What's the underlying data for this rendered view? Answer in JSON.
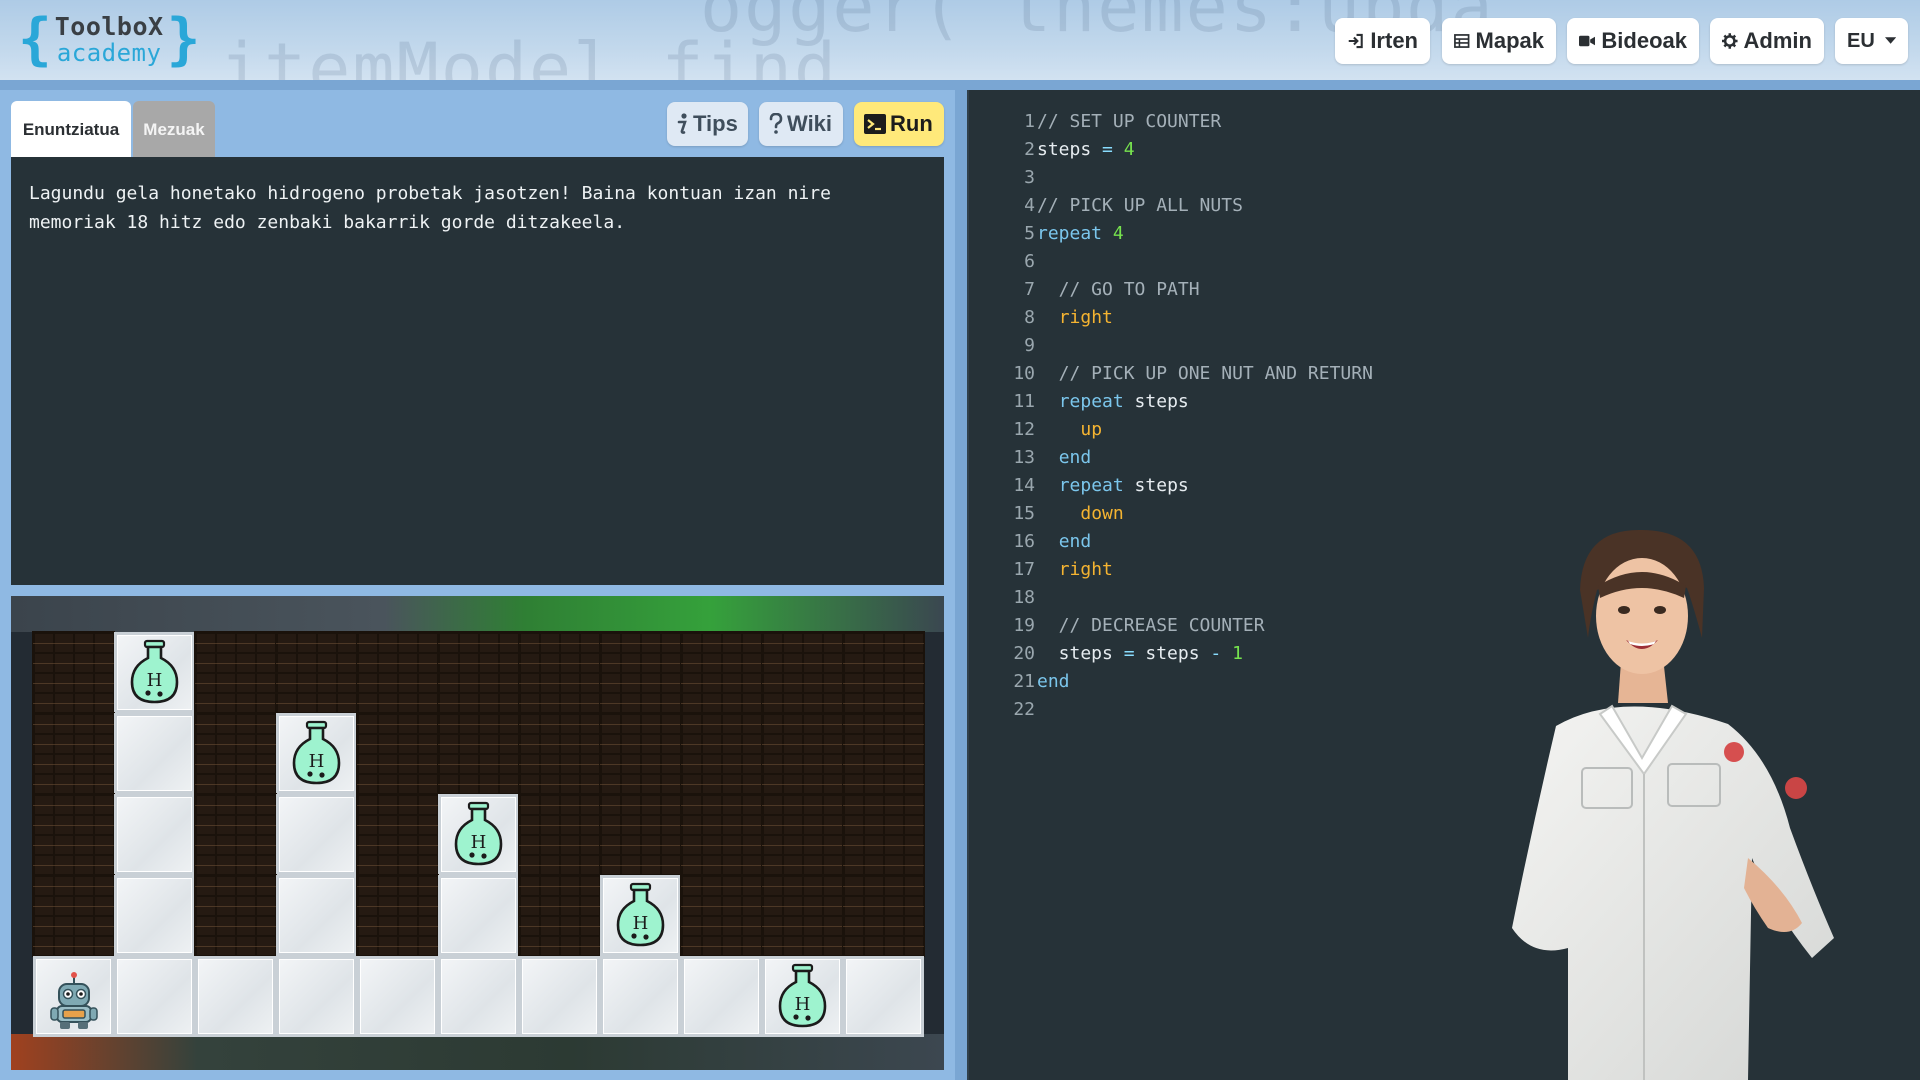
{
  "header": {
    "logo": {
      "line1": "ToolboX",
      "line2": "academy",
      "brace_open": "{",
      "brace_close": "}"
    },
    "background_code": {
      "line1": "ogger(\"themes:upda",
      "line2": "itemModel.find"
    },
    "nav": [
      {
        "label": "Irten",
        "icon": "sign-in-icon"
      },
      {
        "label": "Mapak",
        "icon": "table-icon"
      },
      {
        "label": "Bideoak",
        "icon": "video-camera-icon"
      },
      {
        "label": "Admin",
        "icon": "gear-icon"
      }
    ],
    "language": {
      "value": "EU",
      "icon": "caret-down-icon"
    }
  },
  "tabs": [
    {
      "label": "Enuntziatua",
      "active": true
    },
    {
      "label": "Mezuak",
      "active": false
    }
  ],
  "toolbar": {
    "tips": {
      "label": "Tips",
      "icon": "info-icon"
    },
    "wiki": {
      "label": "Wiki",
      "icon": "question-icon"
    },
    "run": {
      "label": "Run",
      "icon": "terminal-icon"
    }
  },
  "statement": "Lagundu gela honetako hidrogeno probetak jasotzen! Baina kontuan izan nire\nmemoriak 18 hitz edo zenbaki bakarrik gorde ditzakeela.",
  "game": {
    "flask_label": "H",
    "colors": {
      "wall": "#251a12",
      "tile": "#e9edf0",
      "flask": "#9ef3cf"
    },
    "columns": 11,
    "rows": 5
  },
  "code": {
    "lines": [
      [
        {
          "t": "// SET UP COUNTER",
          "c": "comment"
        }
      ],
      [
        {
          "t": "steps",
          "c": "ident"
        },
        {
          "t": " = ",
          "c": "op"
        },
        {
          "t": "4",
          "c": "num"
        }
      ],
      [],
      [
        {
          "t": "// PICK UP ALL NUTS",
          "c": "comment"
        }
      ],
      [
        {
          "t": "repeat",
          "c": "keyword"
        },
        {
          "t": " ",
          "c": "ident"
        },
        {
          "t": "4",
          "c": "num"
        }
      ],
      [],
      [
        {
          "t": "  // GO TO PATH",
          "c": "comment"
        }
      ],
      [
        {
          "t": "  ",
          "c": "ident"
        },
        {
          "t": "right",
          "c": "move"
        }
      ],
      [],
      [
        {
          "t": "  // PICK UP ONE NUT AND RETURN",
          "c": "comment"
        }
      ],
      [
        {
          "t": "  ",
          "c": "ident"
        },
        {
          "t": "repeat",
          "c": "keyword"
        },
        {
          "t": " steps",
          "c": "ident"
        }
      ],
      [
        {
          "t": "    ",
          "c": "ident"
        },
        {
          "t": "up",
          "c": "move"
        }
      ],
      [
        {
          "t": "  ",
          "c": "ident"
        },
        {
          "t": "end",
          "c": "keyword"
        }
      ],
      [
        {
          "t": "  ",
          "c": "ident"
        },
        {
          "t": "repeat",
          "c": "keyword"
        },
        {
          "t": " steps",
          "c": "ident"
        }
      ],
      [
        {
          "t": "    ",
          "c": "ident"
        },
        {
          "t": "down",
          "c": "move"
        }
      ],
      [
        {
          "t": "  ",
          "c": "ident"
        },
        {
          "t": "end",
          "c": "keyword"
        }
      ],
      [
        {
          "t": "  ",
          "c": "ident"
        },
        {
          "t": "right",
          "c": "move"
        }
      ],
      [],
      [
        {
          "t": "  // DECREASE COUNTER",
          "c": "comment"
        }
      ],
      [
        {
          "t": "  steps",
          "c": "ident"
        },
        {
          "t": " = ",
          "c": "op"
        },
        {
          "t": "steps",
          "c": "ident"
        },
        {
          "t": " - ",
          "c": "op"
        },
        {
          "t": "1",
          "c": "num"
        }
      ],
      [
        {
          "t": "end",
          "c": "keyword"
        }
      ],
      []
    ]
  }
}
